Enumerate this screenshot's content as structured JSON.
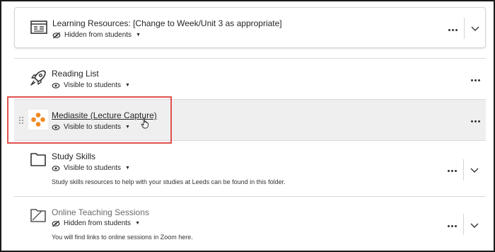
{
  "items": [
    {
      "title": "Learning Resources: [Change to Week/Unit 3 as appropriate]",
      "visibility": "Hidden from students",
      "icon": "learning-module-icon",
      "description": ""
    },
    {
      "title": "Reading List",
      "visibility": "Visible to students",
      "icon": "rocket-icon",
      "description": ""
    },
    {
      "title": "Mediasite (Lecture Capture)",
      "visibility": "Visible to students",
      "icon": "mediasite-logo-icon",
      "description": ""
    },
    {
      "title": "Study Skills",
      "visibility": "Visible to students",
      "icon": "folder-icon",
      "description": "Study skills resources to help with your studies at Leeds can be found in this folder."
    },
    {
      "title": "Online Teaching Sessions",
      "visibility": "Hidden from students",
      "icon": "folder-hidden-icon",
      "description": "You will find links to online sessions in Zoom here."
    }
  ],
  "colors": {
    "highlight_row": "#efefef",
    "annotation_box": "#e0524f",
    "mediasite_orange": "#f08a24"
  }
}
